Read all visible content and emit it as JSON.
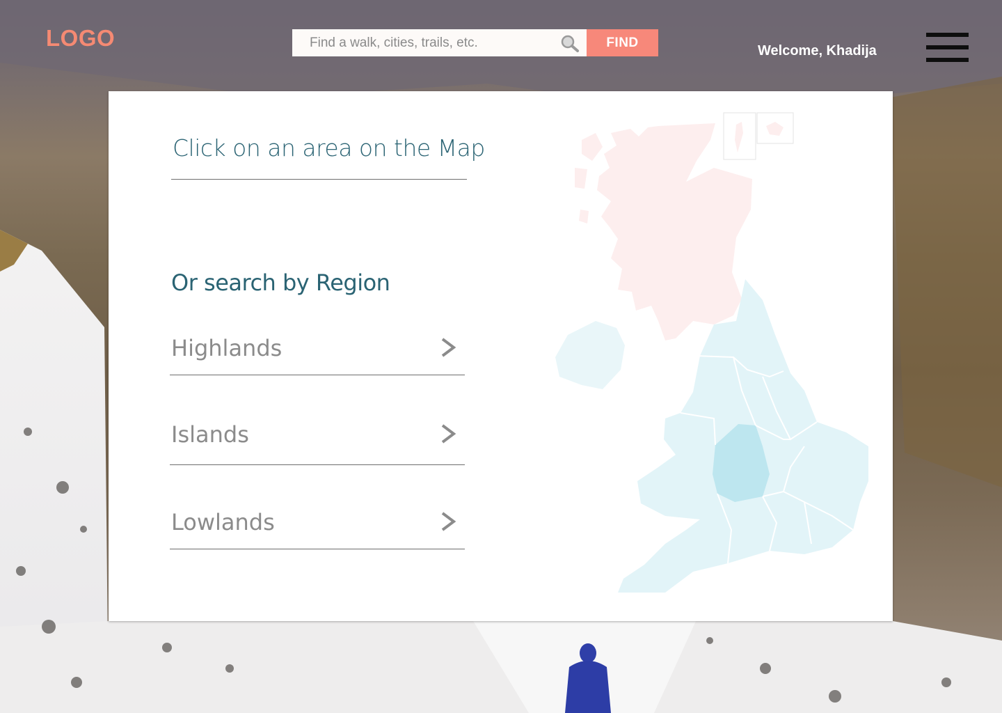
{
  "header": {
    "logo": "LOGO",
    "search": {
      "placeholder": "Find a walk, cities, trails, etc.",
      "value": ""
    },
    "find_label": "FIND",
    "welcome": "Welcome, Khadija"
  },
  "card": {
    "map_prompt": "Click on an area on the Map",
    "region_prompt": "Or search by Region",
    "regions": [
      {
        "label": "Highlands"
      },
      {
        "label": "Islands"
      },
      {
        "label": "Lowlands"
      }
    ]
  },
  "colors": {
    "accent": "#f7887a",
    "heading": "#2a6373",
    "scotland": "#fdeeee",
    "england_wales": "#e2f4f8",
    "selected_region": "#bde6ef"
  },
  "icons": [
    "search-icon",
    "hamburger-menu-icon",
    "chevron-right-icon"
  ]
}
